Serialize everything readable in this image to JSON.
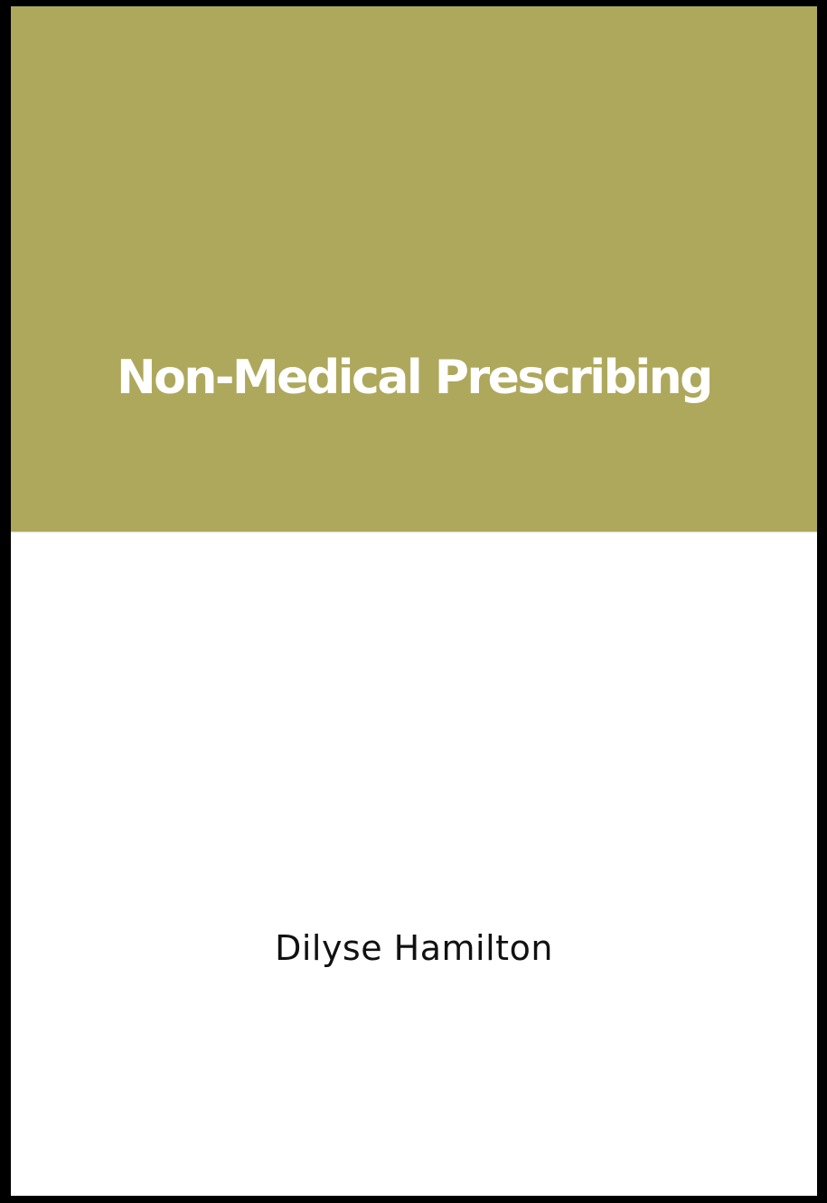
{
  "cover": {
    "title": "Non-Medical Prescribing",
    "author": "Dilyse Hamilton",
    "colors": {
      "top_panel": "#aea85c",
      "bottom_panel": "#ffffff",
      "frame": "#000000",
      "title_text": "#ffffff",
      "author_text": "#111111"
    }
  }
}
